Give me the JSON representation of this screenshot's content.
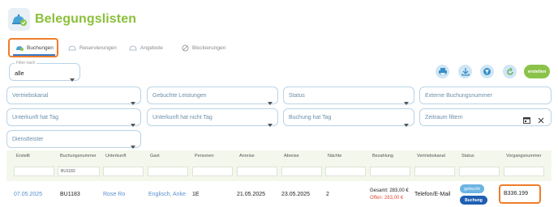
{
  "app": {
    "title": "Belegungslisten"
  },
  "tabs": [
    {
      "label": "Buchungen",
      "active": true
    },
    {
      "label": "Reservierungen"
    },
    {
      "label": "Angebote"
    },
    {
      "label": "Blockierungen"
    }
  ],
  "filter_top": {
    "label": "Filter nach",
    "value": "alle"
  },
  "create_label": "erstellen",
  "fields": {
    "vertriebskanal": "Vertriebskanal",
    "leistungen": "Gebuchte Leistungen",
    "status": "Status",
    "externe": "Externe Buchungsnummer",
    "unterkunft_hat": "Unterkunft hat Tag",
    "unterkunft_nicht": "Unterkunft hat nicht Tag",
    "buchung_hat": "Buchung hat Tag",
    "zeitraum": "Zeitraum filtern",
    "dienstleister": "Dienstleister"
  },
  "table": {
    "headers": [
      "Erstellt",
      "Buchungsnummer",
      "Unterkunft",
      "Gast",
      "Personen",
      "Anreise",
      "Abreise",
      "Nächte",
      "Bezahlung",
      "Vertriebskanal",
      "Status",
      "Vorgangsnummer"
    ],
    "filter_value": "BU1183",
    "row": {
      "created": "07.05.2025",
      "booking_no": "BU1183",
      "accommodation": "Rose Ro",
      "guest": "Englisch, Anke",
      "persons": "1E",
      "arrival": "21.05.2025",
      "departure": "23.05.2025",
      "nights": "2",
      "payment_total": "Gesamt: 283,00 €",
      "payment_open": "Offen: 283,00 €",
      "channel": "Telefon/E-Mail",
      "status_1": "gebucht",
      "status_2": "Buchung",
      "order_no": "B336.199"
    }
  },
  "colors": {
    "accent": "#8bbf3a",
    "highlight": "#ee7d2b",
    "link": "#5a8fcf",
    "danger": "#e24d3b"
  }
}
